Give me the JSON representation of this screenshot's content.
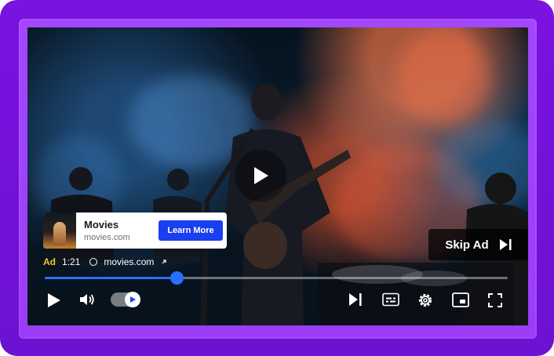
{
  "player": {
    "play_overlay_icon": "play-icon",
    "ad_card": {
      "thumbnail_icon": "movie-poster-thumbnail",
      "title": "Movies",
      "domain": "movies.com",
      "cta_label": "Learn More"
    },
    "skip_ad": {
      "label": "Skip Ad",
      "icon": "skip-next-icon"
    },
    "ad_info": {
      "ad_label": "Ad",
      "time": "1:21",
      "domain": "movies.com",
      "link_icon": "external-link-icon"
    },
    "progress": {
      "fraction": 0.285
    },
    "controls": {
      "play_icon": "play-icon",
      "volume_icon": "volume-icon",
      "autoplay_toggle_on": true,
      "next_icon": "skip-next-icon",
      "captions_icon": "captions-icon",
      "settings_icon": "gear-icon",
      "pip_icon": "picture-in-picture-icon",
      "fullscreen_icon": "fullscreen-icon"
    },
    "colors": {
      "accent": "#2b6fff",
      "cta": "#1a3ff0",
      "ad_label": "#f5c534",
      "frame": "#7a12e0"
    }
  }
}
